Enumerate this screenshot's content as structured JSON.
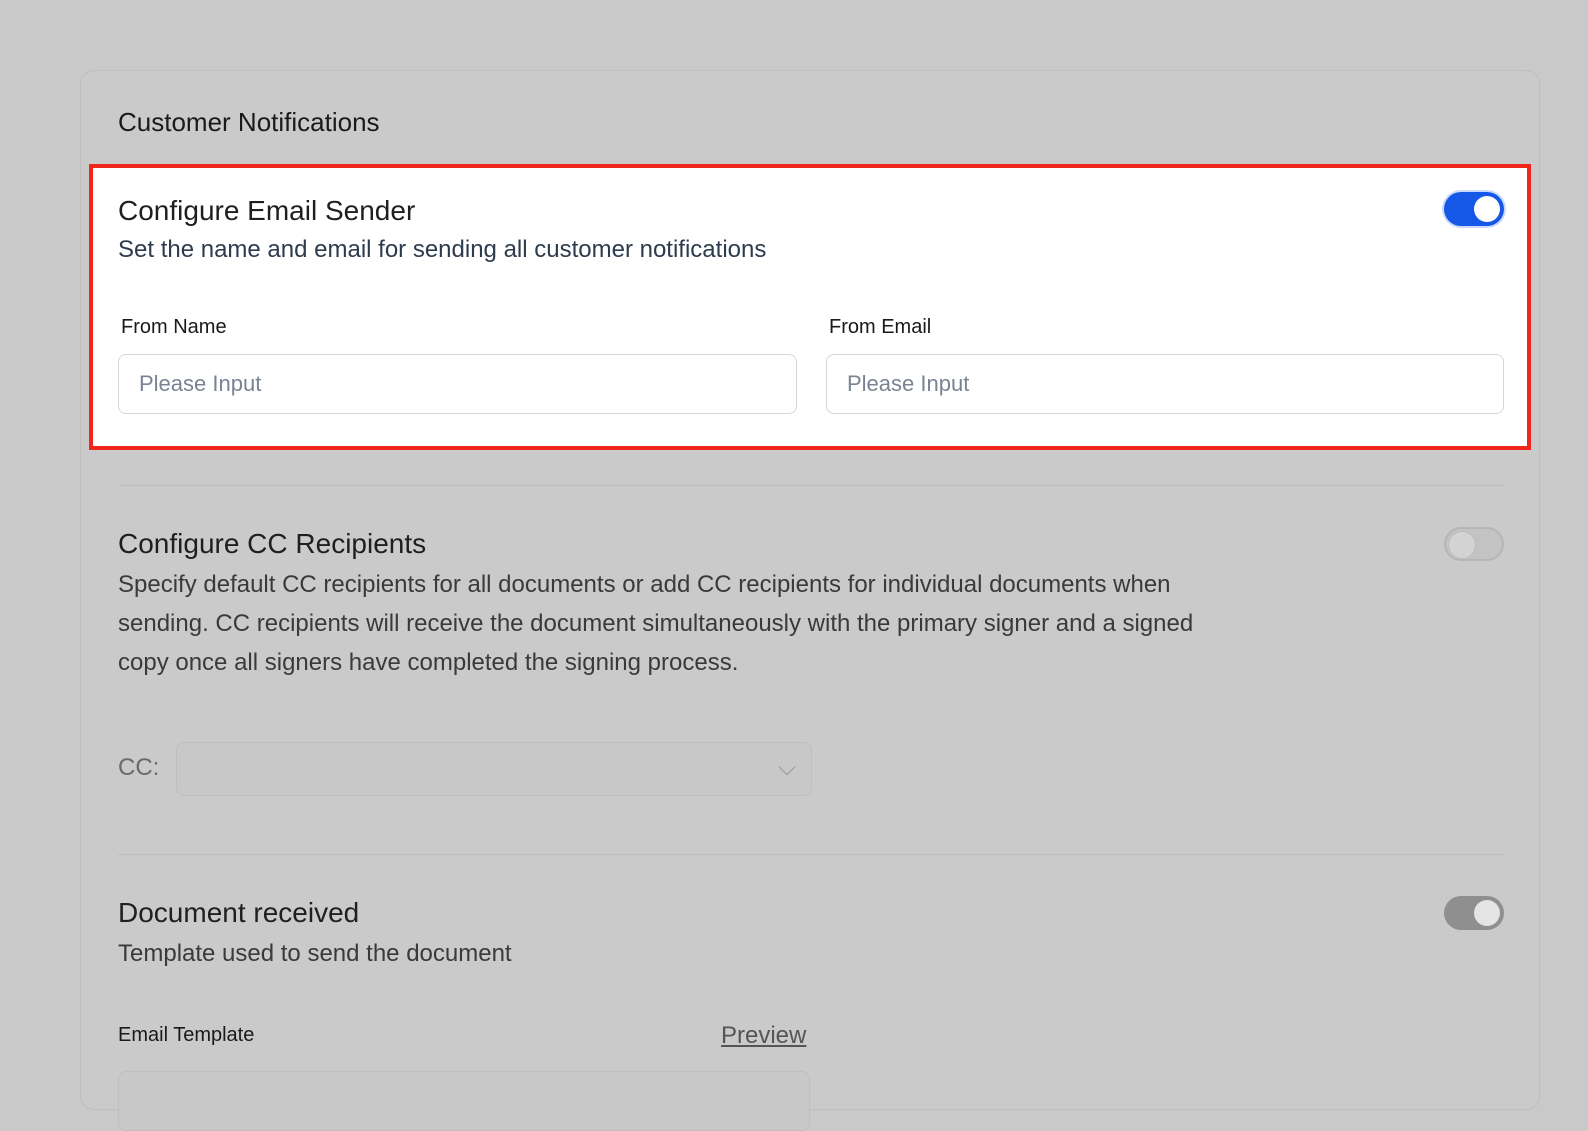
{
  "card": {
    "title": "Customer Notifications"
  },
  "email_sender": {
    "title": "Configure Email Sender",
    "description": "Set the name and email for sending all customer notifications",
    "toggle_state": "on",
    "from_name": {
      "label": "From Name",
      "placeholder": "Please Input",
      "value": ""
    },
    "from_email": {
      "label": "From Email",
      "placeholder": "Please Input",
      "value": ""
    }
  },
  "cc_recipients": {
    "title": "Configure CC Recipients",
    "description": "Specify default CC recipients for all documents or add CC recipients for individual documents when sending. CC recipients will receive the document simultaneously with the primary signer and a signed copy once all signers have completed the signing process.",
    "toggle_state": "off",
    "cc_label": "CC:",
    "cc_value": ""
  },
  "document_received": {
    "title": "Document received",
    "description": "Template used to send the document",
    "toggle_state": "on",
    "email_template_label": "Email Template",
    "preview_label": "Preview"
  },
  "colors": {
    "highlight_border": "#f0261c",
    "toggle_on": "#1557e6",
    "overlay_background": "#c9c9c9"
  }
}
